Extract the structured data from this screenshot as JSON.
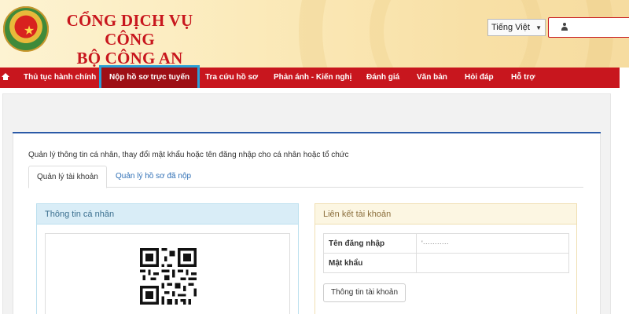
{
  "header": {
    "title_line1": "CỔNG DỊCH VỤ CÔNG",
    "title_line2": "BỘ CÔNG AN",
    "language": "Tiếng Việt",
    "emblem_icon": "police-emblem-icon"
  },
  "nav": {
    "items": [
      {
        "label": "Thủ tục hành chính"
      },
      {
        "label": "Nộp hồ sơ trực tuyến",
        "active": true
      },
      {
        "label": "Tra cứu hồ sơ"
      },
      {
        "label": "Phản ánh - Kiến nghị"
      },
      {
        "label": "Đánh giá"
      },
      {
        "label": "Văn bản"
      },
      {
        "label": "Hỏi đáp"
      },
      {
        "label": "Hỗ trợ"
      }
    ],
    "accent": "#c8161e",
    "highlight": "#2a9fd6"
  },
  "main": {
    "intro": "Quản lý thông tin cá nhân, thay đổi mật khẩu hoặc tên đăng nhập cho cá nhân hoặc tổ chức",
    "tabs": [
      {
        "label": "Quản lý tài khoản",
        "active": true
      },
      {
        "label": "Quản lý hồ sơ đã nộp"
      }
    ],
    "personal_card": {
      "title": "Thông tin cá nhân"
    },
    "link_card": {
      "title": "Liên kết tài khoản",
      "rows": [
        {
          "label": "Tên đăng nhập",
          "value": "'···········"
        },
        {
          "label": "Mật khẩu",
          "value": ""
        }
      ],
      "button": "Thông tin tài khoản"
    }
  }
}
